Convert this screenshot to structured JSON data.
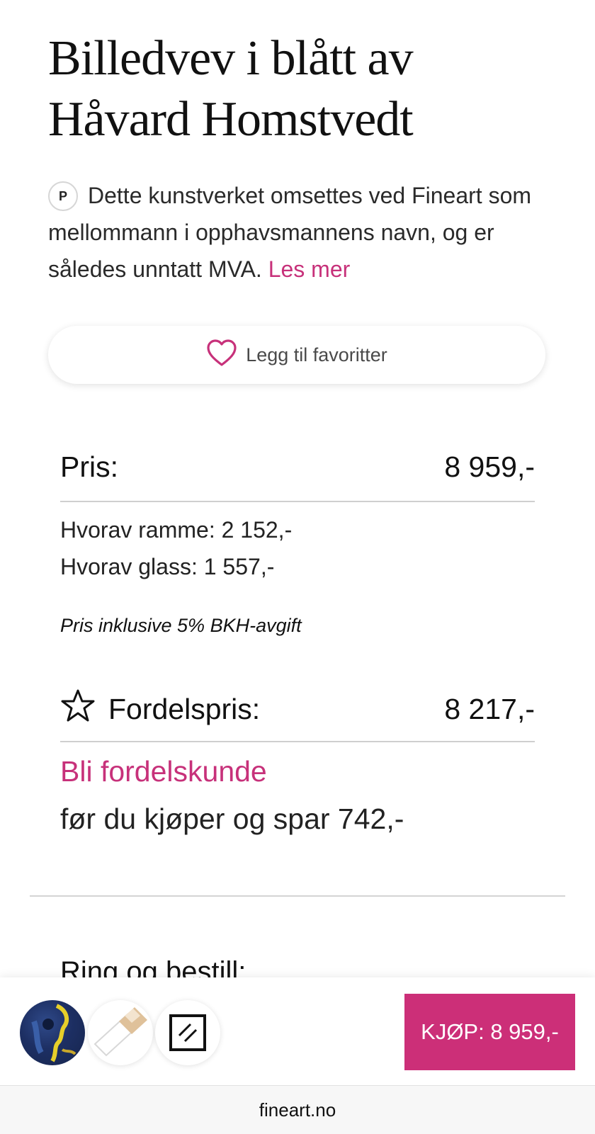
{
  "product": {
    "title_line1": "Billedvev i blått av",
    "title_line2": "Håvard Homstvedt"
  },
  "vat_notice": {
    "badge": "P",
    "text": "Dette kunstverket omsettes ved Fineart som mellommann i opphavsmannens navn, og er således unntatt MVA.",
    "link": "Les mer"
  },
  "favorite_button": {
    "label": "Legg til favoritter",
    "icon": "heart-icon"
  },
  "price": {
    "label": "Pris:",
    "value": "8 959,-",
    "frame": "Hvorav ramme: 2 152,-",
    "glass": "Hvorav glass: 1 557,-",
    "note": "Pris inklusive 5% BKH-avgift"
  },
  "member_price": {
    "label": "Fordelspris:",
    "value": "8 217,-",
    "icon": "star-icon",
    "link": "Bli fordelskunde",
    "save_text": "før du kjøper og spar 742,-"
  },
  "order": {
    "heading": "Ring og bestill:"
  },
  "bottom_bar": {
    "buy_label": "KJØP: 8 959,-"
  },
  "browser": {
    "url": "fineart.no"
  },
  "colors": {
    "accent": "#cc2f78",
    "link": "#c7317a"
  }
}
